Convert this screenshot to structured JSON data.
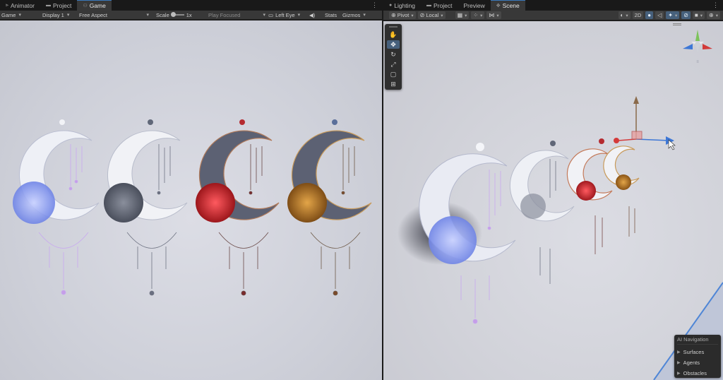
{
  "left_tabs": [
    {
      "label": "Animator",
      "icon": "animator-icon"
    },
    {
      "label": "Project",
      "icon": "folder-icon"
    },
    {
      "label": "Game",
      "icon": "game-controller-icon",
      "active": true
    }
  ],
  "right_tabs": [
    {
      "label": "Lighting",
      "icon": "lightbulb-icon"
    },
    {
      "label": "Project",
      "icon": "folder-icon"
    },
    {
      "label": "Preview",
      "icon": "preview-icon"
    },
    {
      "label": "Scene",
      "icon": "scene-icon",
      "active": true
    }
  ],
  "game_toolbar": {
    "mode": "Game",
    "display": "Display 1",
    "aspect": "Free Aspect",
    "scale_label": "Scale",
    "scale_value": "1x",
    "play_focused": "Play Focused",
    "eye": "Left Eye",
    "stats": "Stats",
    "gizmos": "Gizmos"
  },
  "scene_toolbar": {
    "pivot": "Pivot",
    "local": "Local",
    "two_d": "2D"
  },
  "ai_navigation": {
    "title": "AI Navigation",
    "items": [
      "Surfaces",
      "Agents",
      "Obstacles"
    ]
  },
  "colors": {
    "accent": "#3a79bb",
    "active_tool": "#46607c",
    "moon_white": "#eef0f5",
    "moon_gray": "#5e6375",
    "red_lotus": "#c8252b",
    "gold_lotus": "#b8782a",
    "blue_lotus": "#7f93e6"
  }
}
